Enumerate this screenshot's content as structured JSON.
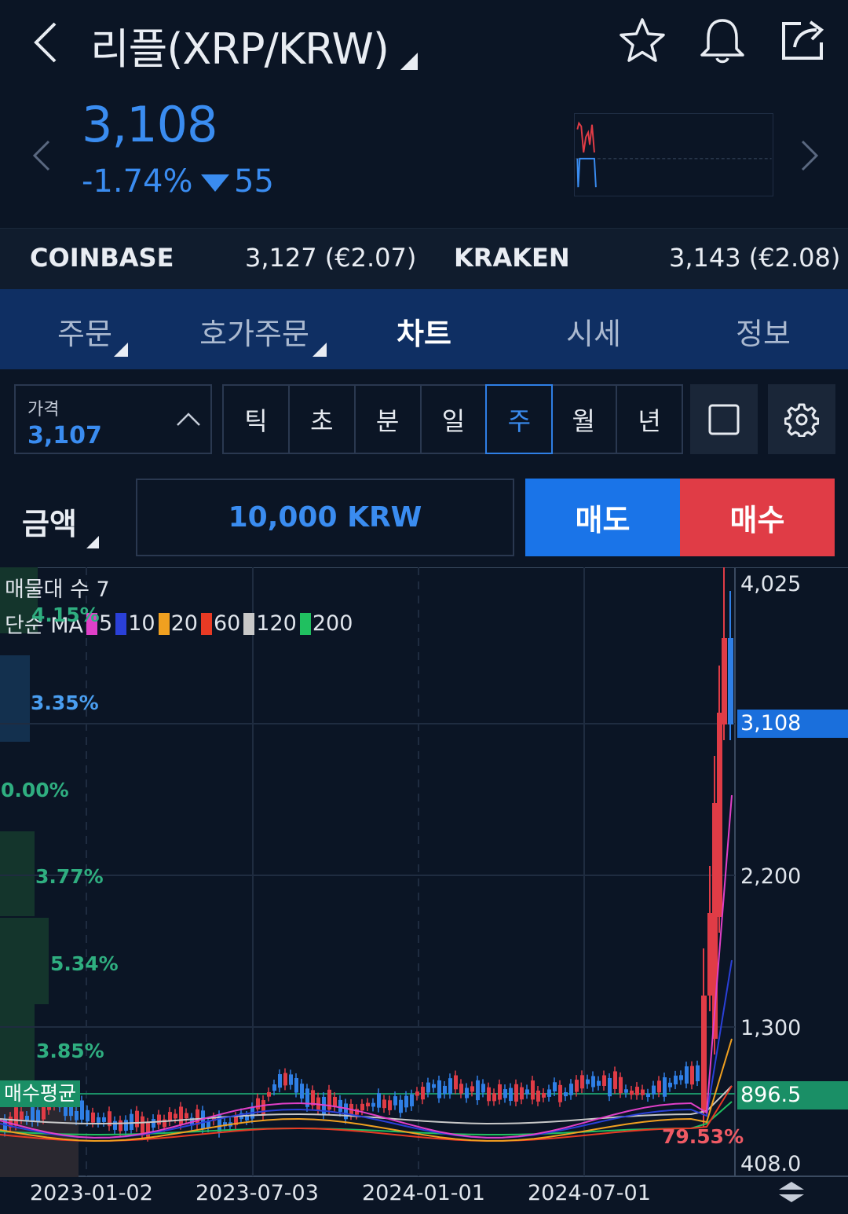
{
  "header": {
    "title": "리플(XRP/KRW)",
    "icons": [
      "back-icon",
      "star-icon",
      "bell-icon",
      "share-icon"
    ]
  },
  "quote": {
    "price": "3,108",
    "change_pct": "-1.74%",
    "change_abs": "55",
    "color_down": "#3a8cf0"
  },
  "exchanges": [
    {
      "name": "COINBASE",
      "value": "3,127 (€2.07)"
    },
    {
      "name": "KRAKEN",
      "value": "3,143 (€2.08)"
    }
  ],
  "tabs": [
    {
      "label": "주문",
      "active": false
    },
    {
      "label": "호가주문",
      "active": false
    },
    {
      "label": "차트",
      "active": true
    },
    {
      "label": "시세",
      "active": false
    },
    {
      "label": "정보",
      "active": false
    }
  ],
  "controls": {
    "price_label": "가격",
    "price_value": "3,107",
    "periods": [
      {
        "label": "틱",
        "active": false
      },
      {
        "label": "초",
        "active": false
      },
      {
        "label": "분",
        "active": false
      },
      {
        "label": "일",
        "active": false
      },
      {
        "label": "주",
        "active": true
      },
      {
        "label": "월",
        "active": false
      },
      {
        "label": "년",
        "active": false
      }
    ]
  },
  "order": {
    "amount_label": "금액",
    "amount_value": "10,000 KRW",
    "sell_label": "매도",
    "buy_label": "매수",
    "sell_color": "#1a74e8",
    "buy_color": "#e03c46"
  },
  "chart": {
    "volume_profile_label": "매물대 수 7",
    "ma_label": "단순 MA",
    "ma_legend": [
      {
        "period": "5",
        "color": "#e040c8"
      },
      {
        "period": "10",
        "color": "#2a40d8"
      },
      {
        "period": "20",
        "color": "#f0a020"
      },
      {
        "period": "60",
        "color": "#e83a24"
      },
      {
        "period": "120",
        "color": "#c8c8c8"
      },
      {
        "period": "200",
        "color": "#20c060"
      }
    ],
    "volume_profile": [
      "4.15%",
      "3.35%",
      "0.00%",
      "3.77%",
      "5.34%",
      "3.85%"
    ],
    "y_ticks": [
      "4,025",
      "2,200",
      "1,300",
      "408.0"
    ],
    "x_ticks": [
      "2023-01-02",
      "2023-07-03",
      "2024-01-01",
      "2024-07-01"
    ],
    "current_price_tag": "3,108",
    "avg_price_tag": "896.5",
    "avg_price_label": "매수평균",
    "return_pct": "79.53%"
  }
}
